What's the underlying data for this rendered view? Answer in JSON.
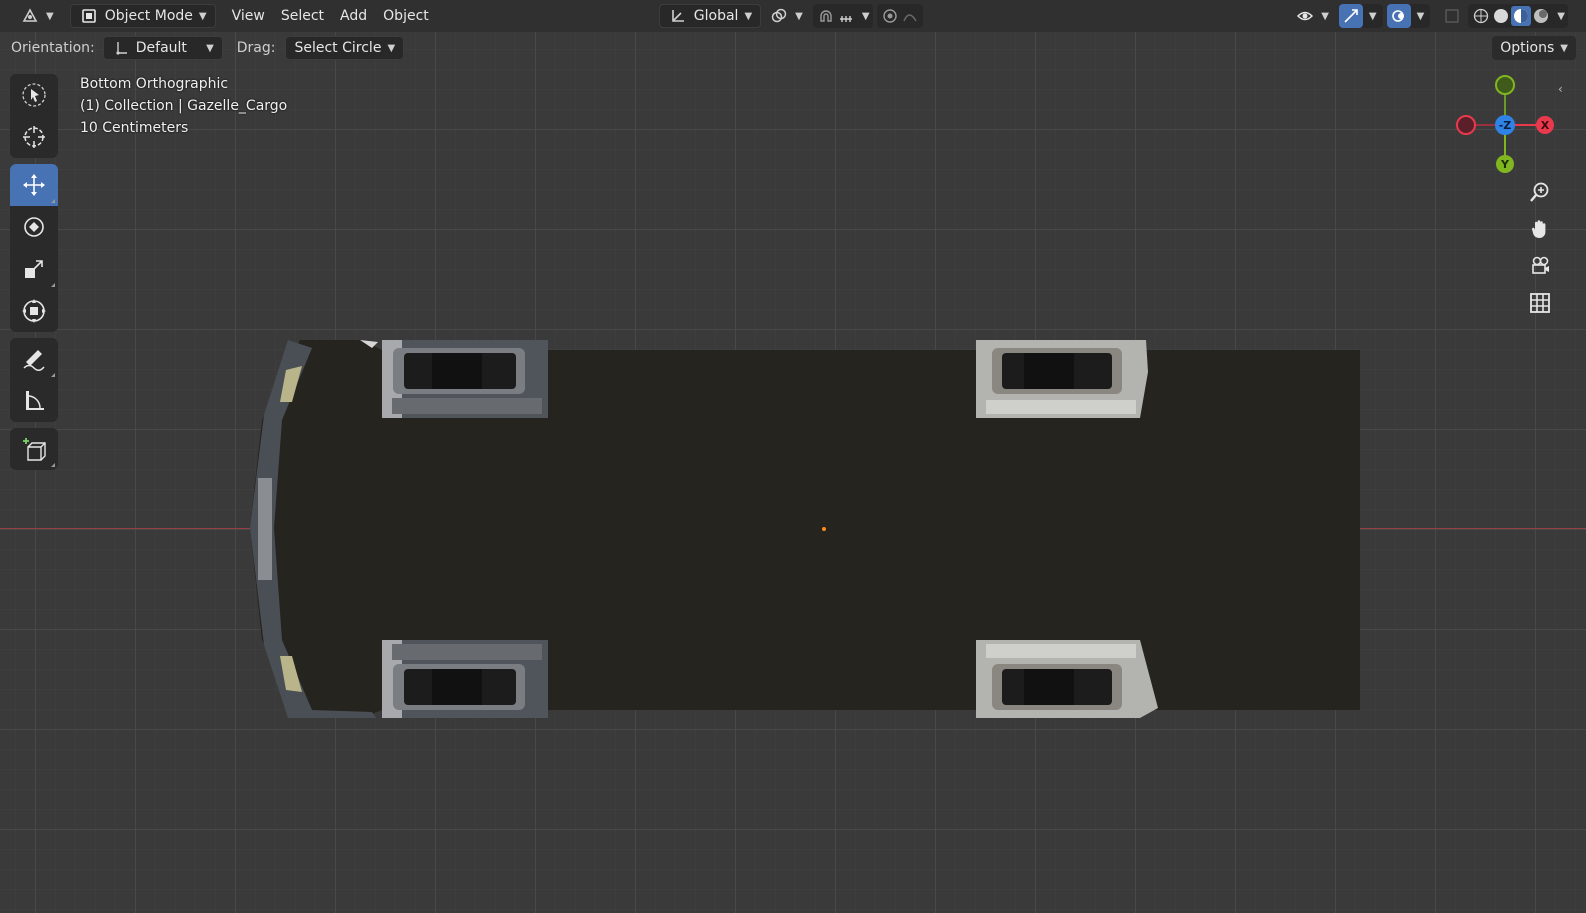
{
  "header": {
    "editor_type_icon": "3d-viewport-icon",
    "mode": "Object Mode",
    "menus": [
      "View",
      "Select",
      "Add",
      "Object"
    ],
    "transform_orientation": "Global"
  },
  "tool_settings": {
    "orientation_label": "Orientation:",
    "orientation_value": "Default",
    "drag_label": "Drag:",
    "drag_value": "Select Circle",
    "options_label": "Options"
  },
  "viewport": {
    "view_name": "Bottom Orthographic",
    "collection_info": "(1) Collection | Gazelle_Cargo",
    "grid_scale": "10 Centimeters"
  },
  "toolbar": {
    "tools": [
      {
        "name": "select-box",
        "icon": "cursor-arrow-icon",
        "active": false
      },
      {
        "name": "cursor",
        "icon": "3d-cursor-icon",
        "active": false
      },
      {
        "name": "move",
        "icon": "move-arrows-icon",
        "active": true
      },
      {
        "name": "rotate",
        "icon": "rotate-icon",
        "active": false
      },
      {
        "name": "scale",
        "icon": "scale-icon",
        "active": false
      },
      {
        "name": "transform",
        "icon": "transform-icon",
        "active": false
      },
      {
        "name": "annotate",
        "icon": "annotate-pencil-icon",
        "active": false
      },
      {
        "name": "measure",
        "icon": "measure-ruler-icon",
        "active": false
      },
      {
        "name": "add-cube",
        "icon": "add-cube-icon",
        "active": false
      }
    ]
  },
  "gizmo": {
    "x_label": "X",
    "y_label": "Y",
    "z_label": "-Z",
    "x_color": "#e8394d",
    "y_color": "#80b61f",
    "z_color": "#2f83e6"
  },
  "colors": {
    "accent": "#4772b3",
    "origin": "#ff8a1f",
    "van_body": "#26241f"
  }
}
